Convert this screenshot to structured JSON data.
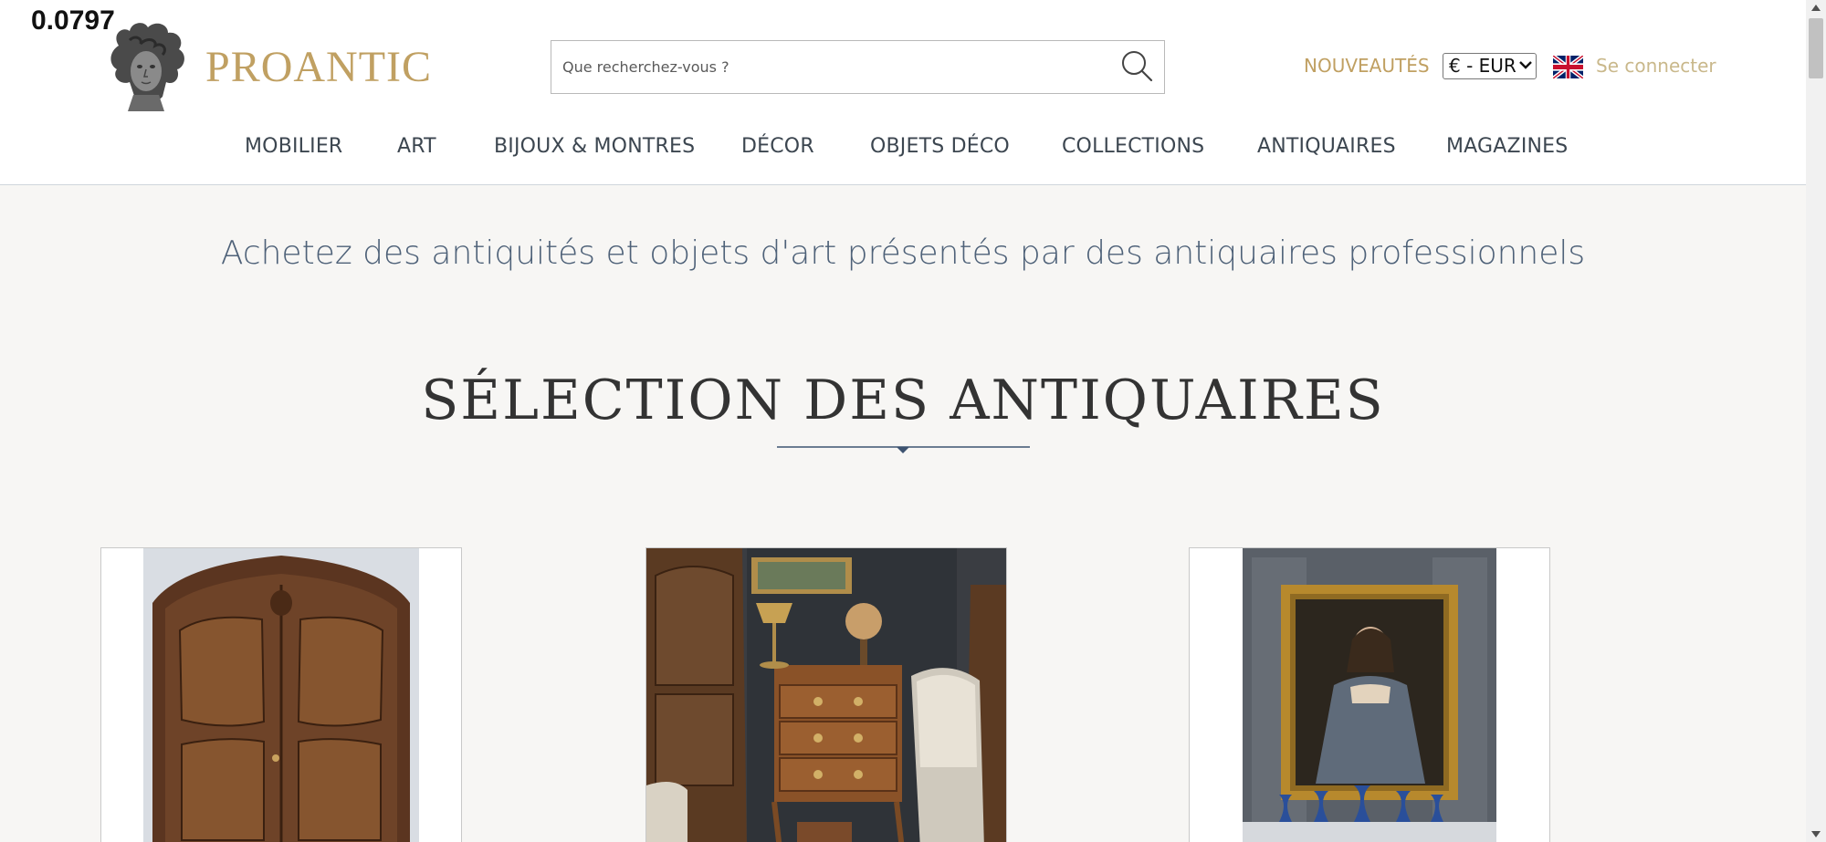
{
  "overlay": {
    "value": "0.0797"
  },
  "header": {
    "brand": "PROANTIC",
    "search": {
      "placeholder": "Que recherchez-vous ?",
      "value": ""
    },
    "nouveautes": "NOUVEAUTÉS",
    "currency": "€ - EUR",
    "connect": "Se connecter"
  },
  "nav": {
    "items": [
      {
        "label": "MOBILIER"
      },
      {
        "label": "ART"
      },
      {
        "label": "BIJOUX & MONTRES"
      },
      {
        "label": "DÉCOR"
      },
      {
        "label": "OBJETS DÉCO"
      },
      {
        "label": "COLLECTIONS"
      },
      {
        "label": "ANTIQUAIRES"
      },
      {
        "label": "MAGAZINES"
      }
    ]
  },
  "main": {
    "tagline": "Achetez des antiquités et objets d'art présentés par des antiquaires professionnels",
    "section_title": "SÉLECTION DES ANTIQUAIRES",
    "cards": [
      {
        "image_icon": "armoire-image"
      },
      {
        "image_icon": "interior-commode-image"
      },
      {
        "image_icon": "portrait-painting-image"
      }
    ]
  },
  "colors": {
    "brand_gold": "#c0a062",
    "nav_text": "#3c4650",
    "tagline_blue": "#4e6178",
    "background": "#f7f6f4"
  }
}
